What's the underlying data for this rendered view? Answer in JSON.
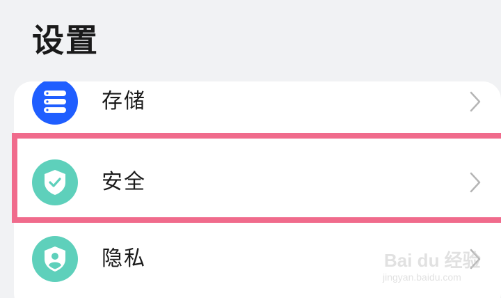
{
  "header": {
    "title": "设置"
  },
  "settings": {
    "items": [
      {
        "label": "存储",
        "icon": "storage-icon",
        "icon_color": "#1f5eff"
      },
      {
        "label": "安全",
        "icon": "shield-check-icon",
        "icon_color": "#5ed0bb",
        "highlighted": true
      },
      {
        "label": "隐私",
        "icon": "privacy-shield-icon",
        "icon_color": "#5ed0bb"
      }
    ]
  },
  "colors": {
    "background": "#f1f2f4",
    "card": "#ffffff",
    "highlight": "#f06b8c",
    "chevron": "#b5b5b5"
  },
  "watermark": {
    "brand": "Bai du 经验",
    "url": "jingyan.baidu.com"
  }
}
